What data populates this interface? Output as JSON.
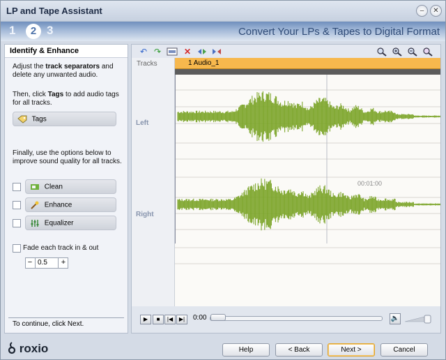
{
  "window": {
    "title": "LP and Tape Assistant"
  },
  "steps": [
    "1",
    "2",
    "3"
  ],
  "active_step": "2",
  "heading": "Convert Your LPs & Tapes to Digital Format",
  "left_panel": {
    "title": "Identify & Enhance",
    "intro_prefix": "Adjust the ",
    "intro_bold": "track separators",
    "intro_suffix": " and delete any unwanted audio.",
    "tags_prefix": "Then, click ",
    "tags_bold": "Tags",
    "tags_suffix": " to add audio tags for all tracks.",
    "tags_button": "Tags",
    "options_text": "Finally, use the options below to improve sound quality for all tracks.",
    "clean_button": "Clean",
    "enhance_button": "Enhance",
    "equalizer_button": "Equalizer",
    "fade_label": "Fade each track in & out",
    "fade_value": "0.5",
    "continue_text": "To continue, click Next."
  },
  "main_panel": {
    "tracks_label": "Tracks",
    "track_name": "1 Audio_1",
    "left_label": "Left",
    "right_label": "Right",
    "timecode": "00:01:00",
    "time_display": "0:00"
  },
  "buttons": {
    "help": "Help",
    "back": "< Back",
    "next": "Next >",
    "cancel": "Cancel"
  },
  "logo": "roxio",
  "colors": {
    "track_bar": "#f7b84d",
    "waveform": "#7da62b",
    "step_bar": "#6f8fbd"
  },
  "icons": [
    "undo-icon",
    "redo-icon",
    "rename-icon",
    "delete-icon",
    "split-icon",
    "merge-icon",
    "zoom-fit-icon",
    "zoom-in-icon",
    "zoom-out-icon",
    "zoom-selection-icon"
  ]
}
